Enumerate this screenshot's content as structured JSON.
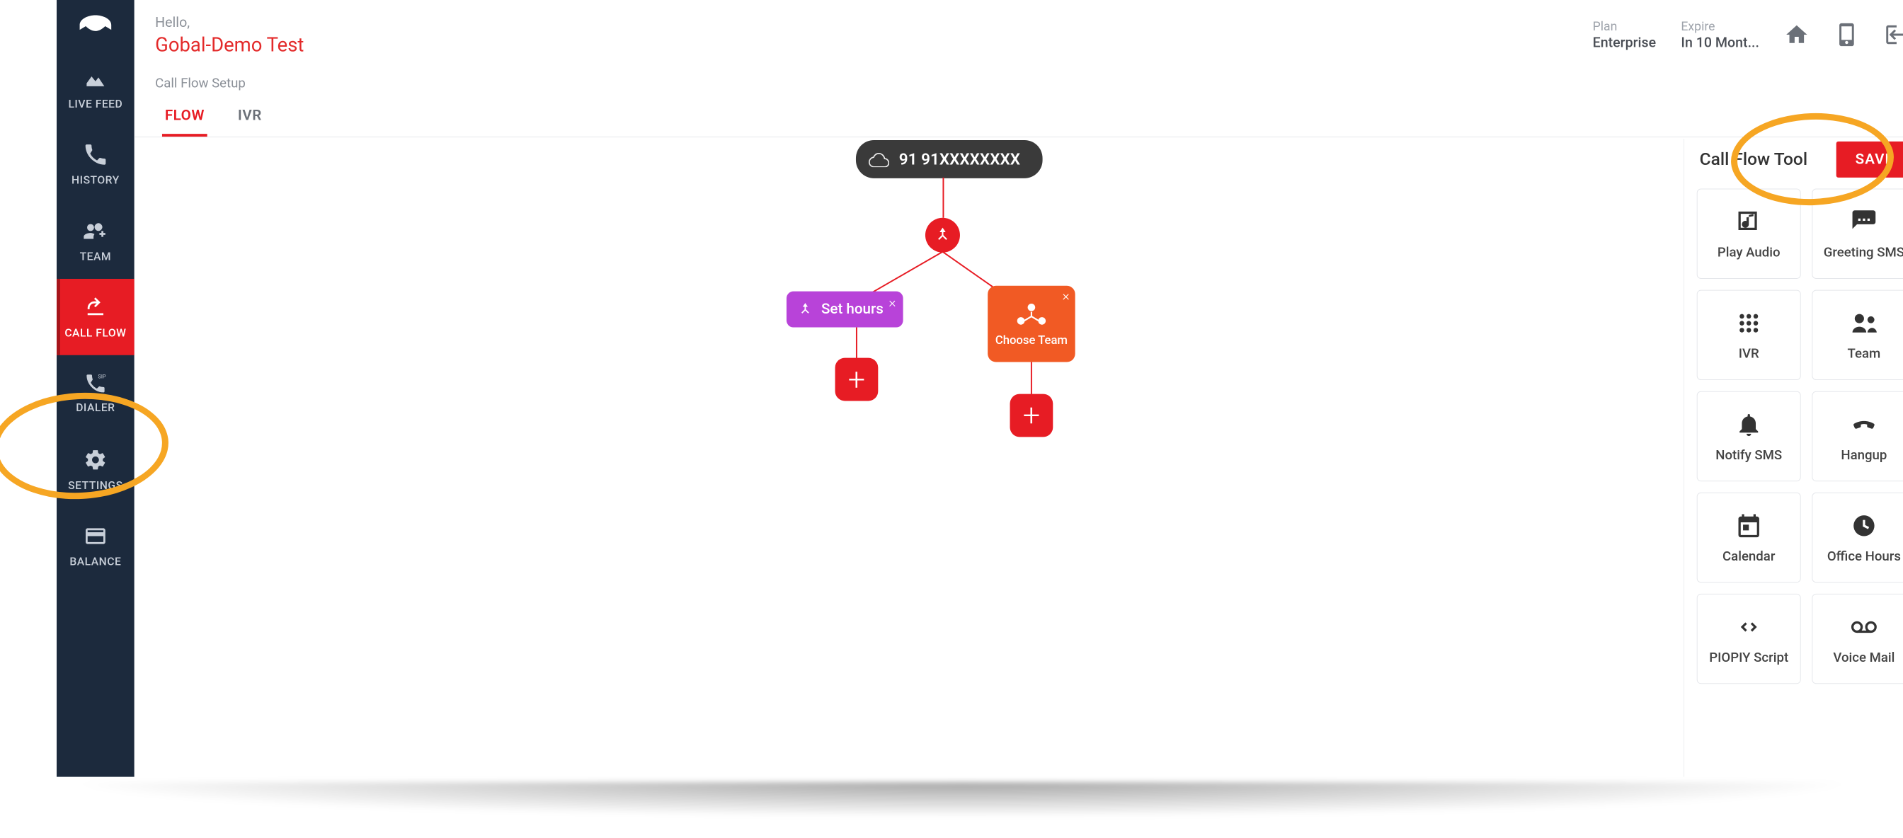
{
  "header": {
    "hello": "Hello,",
    "account_name": "Gobal-Demo Test",
    "plan_label": "Plan",
    "plan_value": "Enterprise",
    "expire_label": "Expire",
    "expire_value": "In 10 Mont..."
  },
  "breadcrumb": "Call Flow Setup",
  "tabs": {
    "flow": "FLOW",
    "ivr": "IVR"
  },
  "sidebar": {
    "items": [
      {
        "label": "LIVE FEED"
      },
      {
        "label": "HISTORY"
      },
      {
        "label": "TEAM"
      },
      {
        "label": "CALL FLOW"
      },
      {
        "label": "DIALER"
      },
      {
        "label": "SETTINGS"
      },
      {
        "label": "BALANCE"
      }
    ]
  },
  "canvas": {
    "number": "91 91XXXXXXXX",
    "set_hours": "Set hours",
    "choose_team": "Choose Team"
  },
  "tools": {
    "title": "Call Flow Tool",
    "save": "SAVE",
    "items": [
      "Play Audio",
      "Greeting SMS",
      "IVR",
      "Team",
      "Notify SMS",
      "Hangup",
      "Calendar",
      "Office Hours",
      "PIOPIY Script",
      "Voice Mail"
    ]
  }
}
